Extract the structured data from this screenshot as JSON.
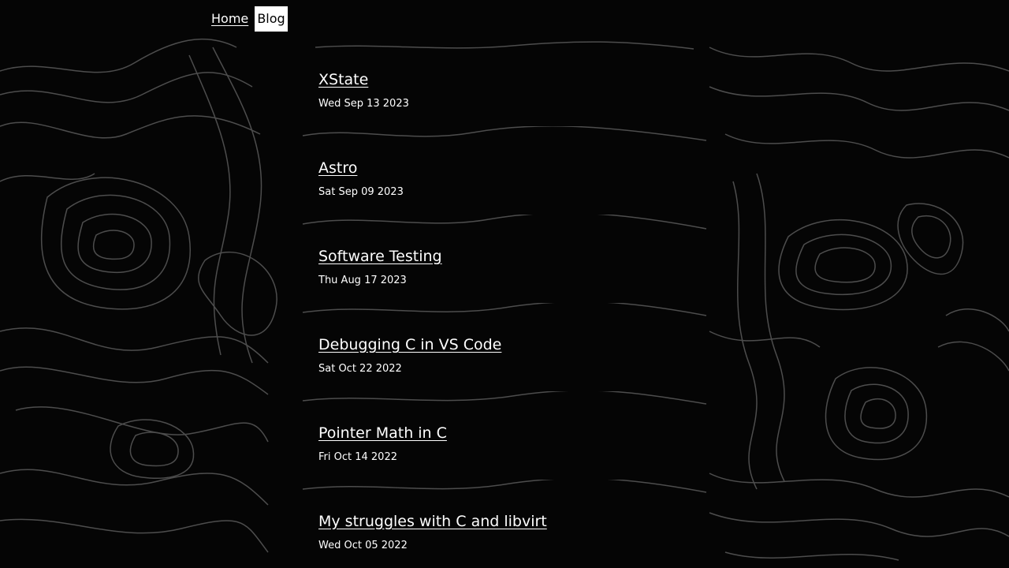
{
  "nav": {
    "home_label": "Home",
    "blog_label": "Blog"
  },
  "posts": [
    {
      "title": "XState",
      "date": "Wed Sep 13 2023"
    },
    {
      "title": "Astro",
      "date": "Sat Sep 09 2023"
    },
    {
      "title": "Software Testing",
      "date": "Thu Aug 17 2023"
    },
    {
      "title": "Debugging C in VS Code",
      "date": "Sat Oct 22 2022"
    },
    {
      "title": "Pointer Math in C",
      "date": "Fri Oct 14 2022"
    },
    {
      "title": "My struggles with C and libvirt",
      "date": "Wed Oct 05 2022"
    }
  ],
  "colors": {
    "background": "#050505",
    "contour": "#5a5a5a",
    "text": "#ffffff",
    "active_nav_bg": "#ffffff",
    "active_nav_text": "#000000"
  }
}
